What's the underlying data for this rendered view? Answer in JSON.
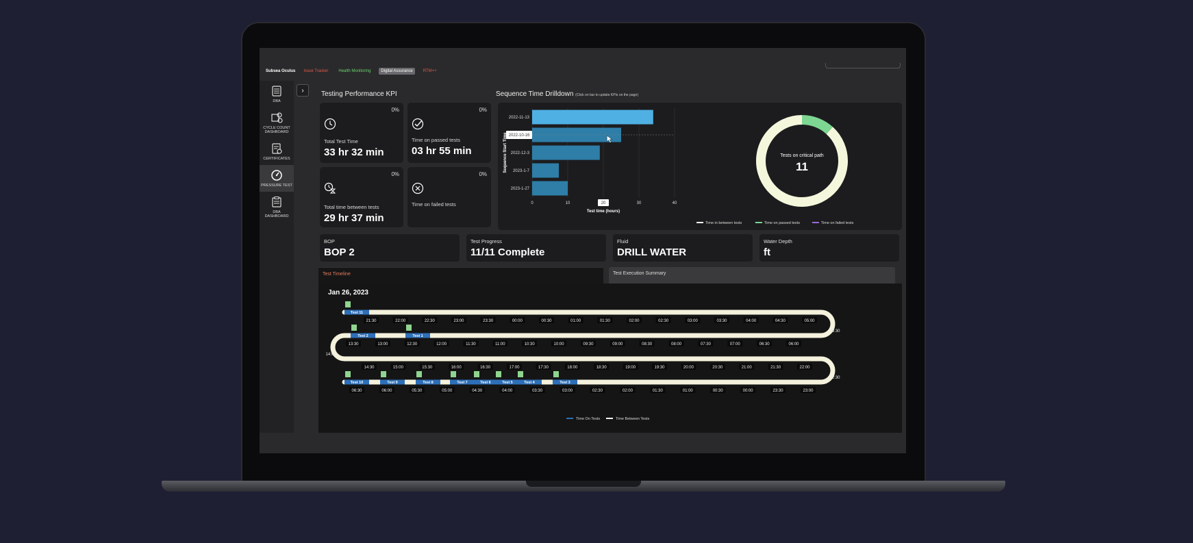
{
  "topbar": {
    "brand": "Subsea Oculus",
    "links": [
      {
        "label": "Issue Tracker",
        "color": "#e05a4a"
      },
      {
        "label": "Health Monitoring",
        "color": "#6bd36b"
      },
      {
        "label": "Digital Assurance",
        "color": "#e8e8e8",
        "active": true
      },
      {
        "label": "RTM++",
        "color": "#e05a4a"
      }
    ]
  },
  "sidebar": {
    "items": [
      {
        "label": "DBA",
        "icon": "database-icon"
      },
      {
        "label": "CYCLE COUNT DASHBOARD",
        "icon": "cycle-count-icon"
      },
      {
        "label": "CERTIFICATES",
        "icon": "certificate-icon"
      },
      {
        "label": "PRESSURE TEST",
        "icon": "gauge-icon",
        "active": true
      },
      {
        "label": "DBA DASHBOARD",
        "icon": "clipboard-icon"
      }
    ]
  },
  "kpi": {
    "title": "Testing Performance KPI",
    "cards": [
      {
        "pct": "0%",
        "label": "Total Test Time",
        "value": "33 hr 32 min",
        "icon": "clock-icon"
      },
      {
        "pct": "0%",
        "label": "Time on passed tests",
        "value": "03 hr 55 min",
        "icon": "check-circle-icon"
      },
      {
        "pct": "0%",
        "label": "Total time between tests",
        "value": "29 hr 37 min",
        "icon": "hourglass-icon"
      },
      {
        "pct": "0%",
        "label": "Time on failed tests",
        "value": "",
        "icon": "x-circle-icon"
      }
    ]
  },
  "drilldown": {
    "title": "Sequence Time Drilldown",
    "subtitle": "(Click on bar to update KPIs on the page)",
    "tooltip": "2022-10-16",
    "cursor_tick": "20"
  },
  "chart_data": [
    {
      "type": "bar",
      "orientation": "horizontal",
      "categories": [
        "2022-11-13",
        "2022-10-16",
        "2022-12-3",
        "2023-1-7",
        "2023-1-27"
      ],
      "values": [
        34,
        25,
        19,
        7.5,
        10
      ],
      "xlabel": "Test time (hours)",
      "ylabel": "Sequence Start Time",
      "xlim": [
        0,
        40
      ],
      "xticks": [
        "0",
        "10",
        "20",
        "30",
        "40"
      ],
      "colors": {
        "highlight": "#4fb0e3",
        "normal": "#2e7ea8"
      }
    },
    {
      "type": "pie",
      "donut": true,
      "center_label": "Tests on critical path",
      "center_value": "11",
      "slices": [
        {
          "name": "Time in between tests",
          "value": 88.3,
          "color": "#f4f7dc"
        },
        {
          "name": "Time on passed tests",
          "value": 11.7,
          "color": "#7dd692"
        },
        {
          "name": "Time on failed tests",
          "value": 0,
          "color": "#9b6bd6"
        }
      ],
      "legend_position": "bottom-right"
    }
  ],
  "info": [
    {
      "label": "BOP",
      "value": "BOP 2"
    },
    {
      "label": "Test Progress",
      "value": "11/11 Complete"
    },
    {
      "label": "Fluid",
      "value": "DRILL WATER"
    },
    {
      "label": "Water Depth",
      "value": "ft"
    }
  ],
  "tabs": {
    "timeline": "Test Timeline",
    "summary": "Test Execution Summary"
  },
  "timeline": {
    "date": "Jan 26, 2023",
    "row1_times": [
      "21:30",
      "22:00",
      "22:30",
      "23:00",
      "23:30",
      "00:00",
      "00:30",
      "01:00",
      "01:30",
      "02:00",
      "02:30",
      "03:00",
      "03:30",
      "04:00",
      "04:30",
      "05:00"
    ],
    "row2_times": [
      "13:30",
      "13:00",
      "12:30",
      "12:00",
      "11:30",
      "11:00",
      "10:30",
      "10:00",
      "09:30",
      "09:00",
      "08:30",
      "08:00",
      "07:30",
      "07:00",
      "06:30",
      "06:00"
    ],
    "row3_times": [
      "14:30",
      "15:00",
      "15:30",
      "16:00",
      "16:30",
      "17:00",
      "17:30",
      "18:00",
      "18:30",
      "19:00",
      "19:30",
      "20:00",
      "20:30",
      "21:00",
      "21:30",
      "22:00"
    ],
    "row4_times": [
      "06:30",
      "06:00",
      "05:30",
      "05:00",
      "04:30",
      "04:00",
      "03:30",
      "03:00",
      "02:30",
      "02:00",
      "01:30",
      "01:00",
      "00:30",
      "00:00",
      "23:30",
      "23:00"
    ],
    "turn_labels": [
      "05:30",
      "14:00",
      "22:30"
    ],
    "row1_tests": [
      "Test 11"
    ],
    "row2_tests": [
      "Test 2",
      "Test 1"
    ],
    "row4_tests": [
      "Test 10",
      "Test 9",
      "Test 8",
      "Test 7",
      "Test 6",
      "Test 5",
      "Test 4",
      "Test 3"
    ],
    "legend": [
      "Time On Tests",
      "Time Between Tests"
    ],
    "colors": {
      "test": "#2d6fb8",
      "between": "#f4f1dc",
      "flag": "#8fd48f"
    }
  }
}
